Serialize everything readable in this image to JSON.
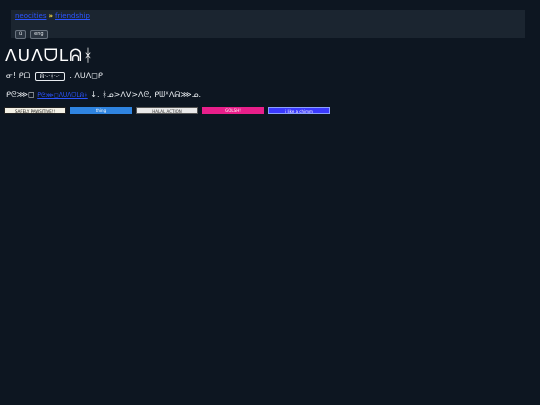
{
  "breadcrumb": {
    "home": "neocities",
    "separator": "»",
    "current": "friendship"
  },
  "language_buttons": [
    "ü",
    "eng"
  ],
  "title": "ᐱᑌᐱᗜᒪᕱᚼ",
  "line1": {
    "prefix": "ᓂ! ᑭᗝ",
    "key": "ᕱ·-·ᚼ·-·",
    "suffix": ". ᐱᑌᐱ◻ᑭ"
  },
  "line2": {
    "prefix": "ᑭᘓ⋙◻",
    "link": "ᑭᘓ⋙◻ᐱᑌᐱᗜᒪᕱᚼ",
    "suffix": "↓. ᚼᓄ>ᐱᐯ>ᐱᘓ, ᑭᗯᕽᐱᕱ⋙ᓄ."
  },
  "badges": [
    "SAFELY PAWSITIVE!!",
    "thing",
    "HALAL ACTION",
    "GOLSH!",
    "i like a chimm"
  ],
  "colors": {
    "background": "#0d1621",
    "topbar": "#1b2530",
    "link": "#2b54ff",
    "separator": "#ffe14a"
  }
}
